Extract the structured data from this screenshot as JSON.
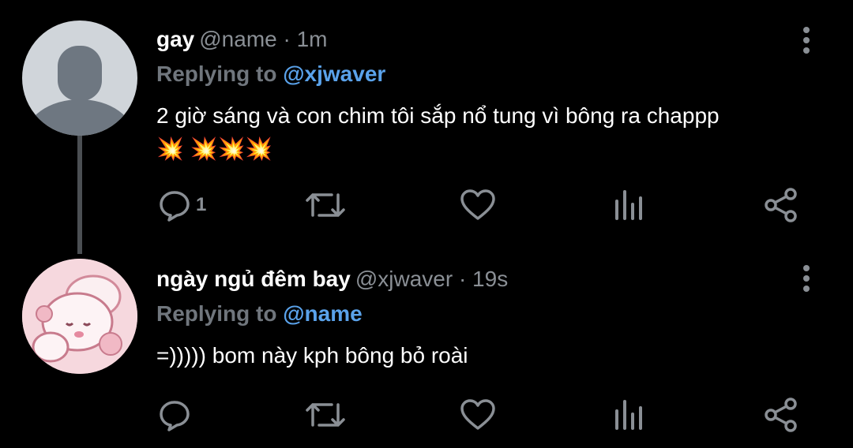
{
  "tweets": [
    {
      "display_name": "gay",
      "handle": "@name",
      "time": "· 1m",
      "replying_prefix": "Replying to",
      "replying_to": "@xjwaver",
      "text": "2 giờ sáng và con chim tôi sắp nổ tung vì bông ra chappp",
      "text_emoji": "💥 💥💥💥",
      "reply_count": "1"
    },
    {
      "display_name": "ngày ngủ đêm bay",
      "handle": "@xjwaver",
      "time": "· 19s",
      "replying_prefix": "Replying to",
      "replying_to": "@name",
      "text": "=))))) bom này kph bông bỏ roài",
      "reply_count": ""
    }
  ],
  "icons": {
    "reply": "reply-icon",
    "retweet": "retweet-icon",
    "like": "heart-icon",
    "views": "analytics-icon",
    "share": "share-icon",
    "more": "more-vertical-icon"
  },
  "colors": {
    "background": "#000000",
    "text": "#ffffff",
    "muted": "#8a8f95",
    "mention": "#5aa2ea",
    "thread_line": "#4b4f53"
  }
}
